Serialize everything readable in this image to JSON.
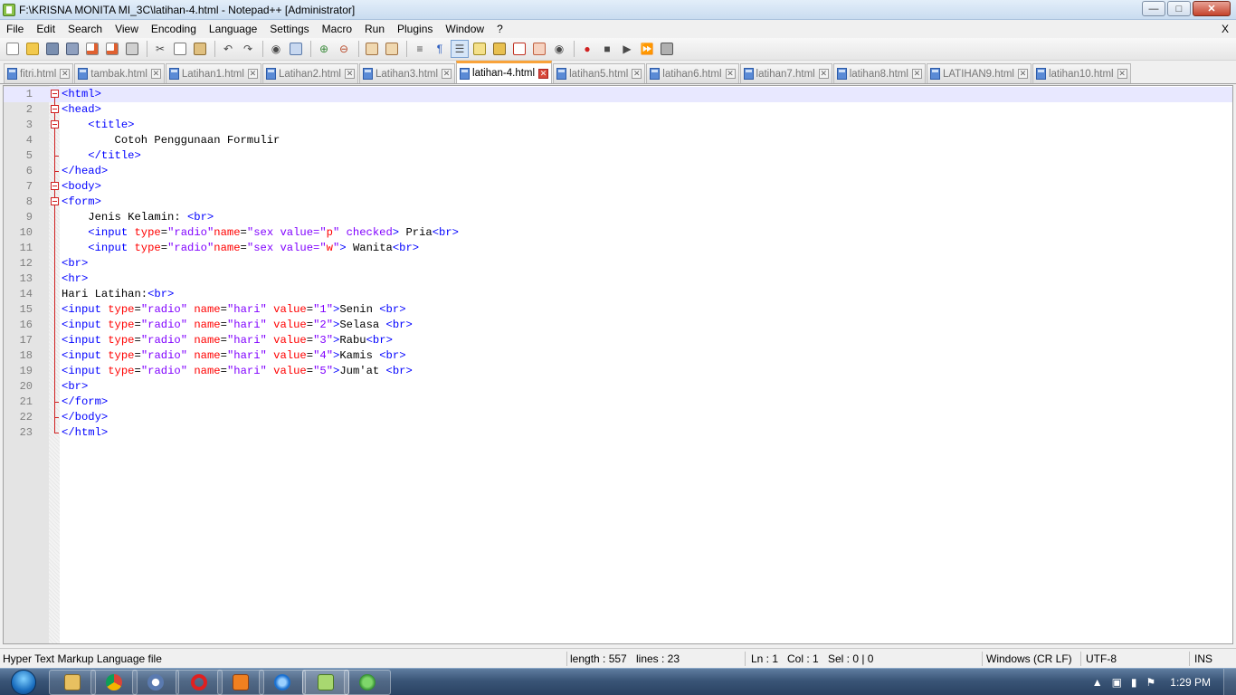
{
  "window": {
    "title": "F:\\KRISNA MONITA MI_3C\\latihan-4.html - Notepad++ [Administrator]",
    "minimize_icon": "minimize-icon",
    "maximize_icon": "maximize-icon",
    "close_icon": "close-icon"
  },
  "menu": {
    "items": [
      "File",
      "Edit",
      "Search",
      "View",
      "Encoding",
      "Language",
      "Settings",
      "Macro",
      "Run",
      "Plugins",
      "Window",
      "?"
    ],
    "close_label": "X"
  },
  "tabs": [
    {
      "label": "fitri.html",
      "active": false
    },
    {
      "label": "tambak.html",
      "active": false
    },
    {
      "label": "Latihan1.html",
      "active": false
    },
    {
      "label": "Latihan2.html",
      "active": false
    },
    {
      "label": "Latihan3.html",
      "active": false
    },
    {
      "label": "latihan-4.html",
      "active": true
    },
    {
      "label": "latihan5.html",
      "active": false
    },
    {
      "label": "latihan6.html",
      "active": false
    },
    {
      "label": "latihan7.html",
      "active": false
    },
    {
      "label": "latihan8.html",
      "active": false
    },
    {
      "label": "LATIHAN9.html",
      "active": false
    },
    {
      "label": "latihan10.html",
      "active": false
    }
  ],
  "editor": {
    "lines": [
      {
        "n": "1",
        "text": "<html>"
      },
      {
        "n": "2",
        "text": "<head>"
      },
      {
        "n": "3",
        "text": "    <title>"
      },
      {
        "n": "4",
        "text": "        Cotoh Penggunaan Formulir"
      },
      {
        "n": "5",
        "text": "    </title>"
      },
      {
        "n": "6",
        "text": "</head>"
      },
      {
        "n": "7",
        "text": "<body>"
      },
      {
        "n": "8",
        "text": "<form>"
      },
      {
        "n": "9",
        "text": "    Jenis Kelamin: <br>"
      },
      {
        "n": "10",
        "text": "    <input type=\"radio\"name=\"sex value=\"p\" checked> Pria<br>"
      },
      {
        "n": "11",
        "text": "    <input type=\"radio\"name=\"sex value=\"w\"> Wanita<br>"
      },
      {
        "n": "12",
        "text": "<br>"
      },
      {
        "n": "13",
        "text": "<hr>"
      },
      {
        "n": "14",
        "text": "Hari Latihan:<br>"
      },
      {
        "n": "15",
        "text": "<input type=\"radio\" name=\"hari\" value=\"1\">Senin <br>"
      },
      {
        "n": "16",
        "text": "<input type=\"radio\" name=\"hari\" value=\"2\">Selasa <br>"
      },
      {
        "n": "17",
        "text": "<input type=\"radio\" name=\"hari\" value=\"3\">Rabu<br>"
      },
      {
        "n": "18",
        "text": "<input type=\"radio\" name=\"hari\" value=\"4\">Kamis <br>"
      },
      {
        "n": "19",
        "text": "<input type=\"radio\" name=\"hari\" value=\"5\">Jum'at <br>"
      },
      {
        "n": "20",
        "text": "<br>"
      },
      {
        "n": "21",
        "text": "</form>"
      },
      {
        "n": "22",
        "text": "</body>"
      },
      {
        "n": "23",
        "text": "</html>"
      }
    ],
    "current_line": 1,
    "colors": {
      "tag": "#0000ff",
      "attr": "#ff0000",
      "string": "#8000ff",
      "text": "#000000",
      "fold": "#d02020"
    }
  },
  "status": {
    "filetype": "Hyper Text Markup Language file",
    "length": "length : 557",
    "lines": "lines : 23",
    "ln": "Ln : 1",
    "col": "Col : 1",
    "sel": "Sel : 0 | 0",
    "eol": "Windows (CR LF)",
    "encoding": "UTF-8",
    "mode": "INS"
  },
  "taskbar": {
    "clock": "1:29 PM",
    "apps": [
      "explorer-icon",
      "chrome-icon",
      "app-icon",
      "opera-icon",
      "media-player-icon",
      "internet-explorer-icon",
      "notepadpp-icon",
      "clover-icon"
    ]
  }
}
